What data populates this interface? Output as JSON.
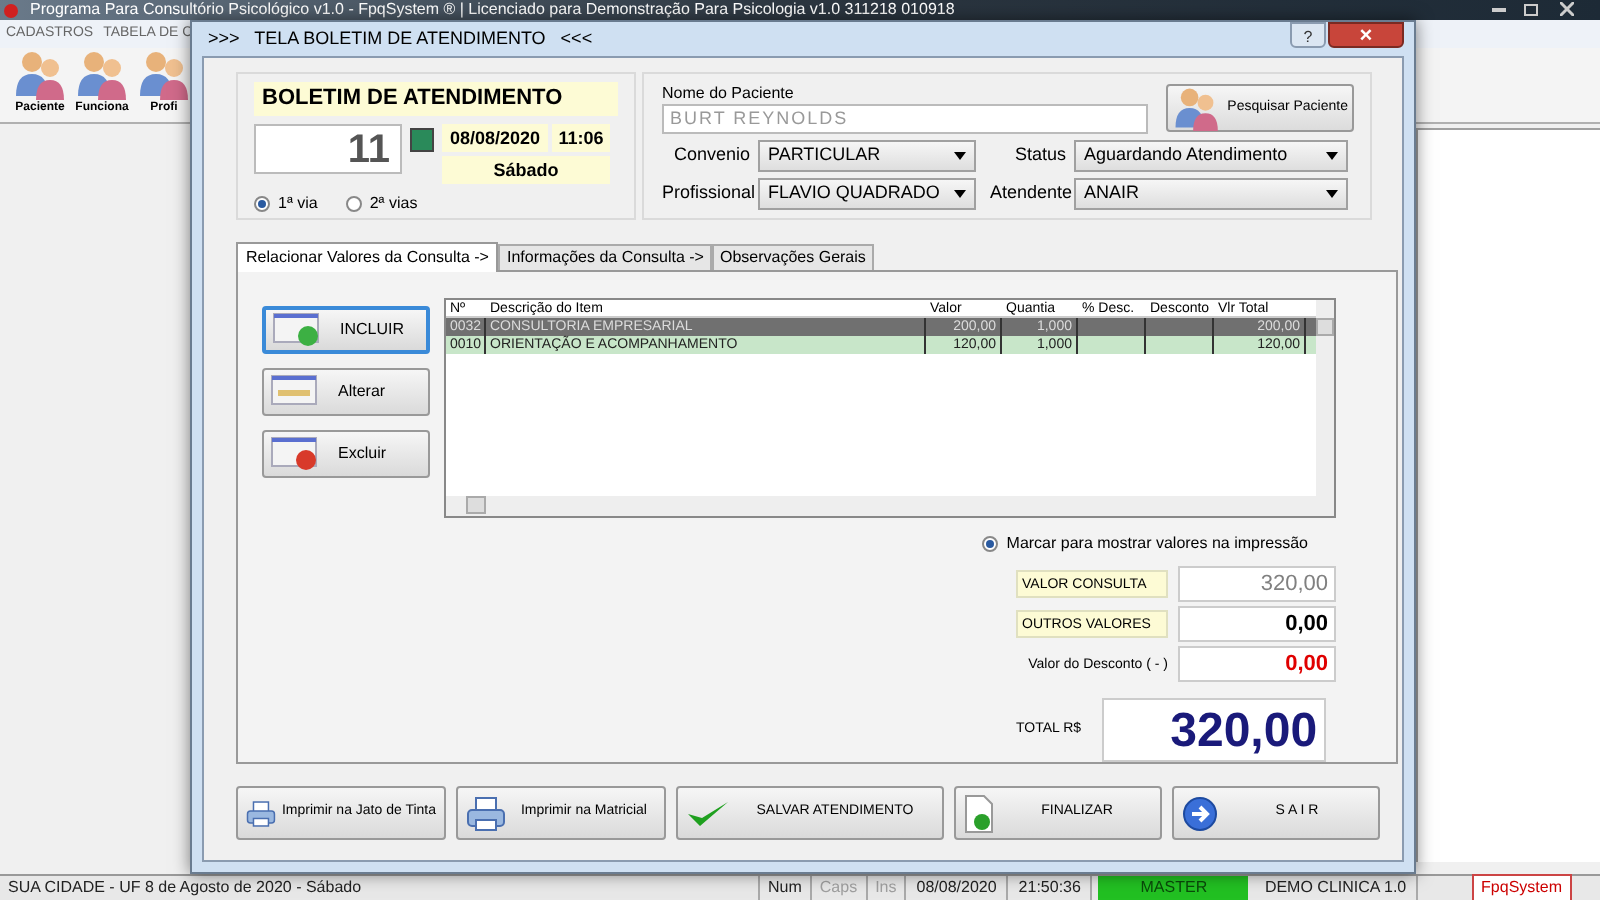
{
  "app": {
    "title": "Programa Para Consultório Psicológico v1.0 - FpqSystem ® | Licenciado para  Demonstração Para Psicologia v1.0 311218 010918",
    "menu": [
      "CADASTROS",
      "TABELA DE C"
    ],
    "toolbar": [
      {
        "label": "Paciente"
      },
      {
        "label": "Funciona"
      },
      {
        "label": "Profi"
      }
    ]
  },
  "dialog": {
    "title": ">>>   TELA BOLETIM DE ATENDIMENTO   <<<",
    "help": "?",
    "close": "×",
    "heading": "BOLETIM DE ATENDIMENTO",
    "number": "11",
    "date": "08/08/2020",
    "time": "11:06",
    "weekday": "Sábado",
    "copies": [
      {
        "label": "1ª via",
        "selected": true
      },
      {
        "label": "2ª vias",
        "selected": false
      }
    ],
    "patient": {
      "label": "Nome do Paciente",
      "value": "BURT REYNOLDS",
      "search_button": "Pesquisar Paciente"
    },
    "selects": [
      {
        "label": "Convenio",
        "value": "PARTICULAR"
      },
      {
        "label": "Status",
        "value": "Aguardando Atendimento"
      },
      {
        "label": "Profissional",
        "value": "FLAVIO QUADRADO"
      },
      {
        "label": "Atendente",
        "value": "ANAIR"
      }
    ],
    "tabs": [
      {
        "label": "Relacionar Valores da Consulta ->",
        "selected": true
      },
      {
        "label": "Informações da Consulta ->",
        "selected": false
      },
      {
        "label": "Observações Gerais",
        "selected": false
      }
    ],
    "actions": [
      {
        "label": "INCLUIR",
        "kind": "add",
        "focused": true
      },
      {
        "label": "Alterar",
        "kind": "edit",
        "focused": false
      },
      {
        "label": "Excluir",
        "kind": "delete",
        "focused": false
      }
    ],
    "table": {
      "columns": [
        "Nº",
        "Descrição do Item",
        "Valor",
        "Quantia",
        "% Desc.",
        "Desconto",
        "Vlr Total"
      ],
      "rows": [
        {
          "cells": [
            "0032",
            "CONSULTORIA EMPRESARIAL",
            "200,00",
            "1,000",
            "",
            "",
            "200,00"
          ],
          "selected": true
        },
        {
          "cells": [
            "0010",
            "ORIENTAÇÃO E ACOMPANHAMENTO",
            "120,00",
            "1,000",
            "",
            "",
            "120,00"
          ],
          "selected": false
        }
      ]
    },
    "print_values": {
      "label": "Marcar para mostrar valores na impressão",
      "checked": true
    },
    "totals": [
      {
        "label": "VALOR CONSULTA",
        "value": "320,00",
        "kind": "highlight",
        "color": "#808080"
      },
      {
        "label": "OUTROS VALORES",
        "value": "0,00",
        "kind": "highlight",
        "color": "#000000"
      },
      {
        "label": "Valor do Desconto ( - )",
        "value": "0,00",
        "kind": "plain",
        "color": "#e00000"
      }
    ],
    "total": {
      "label": "TOTAL R$",
      "value": "320,00"
    },
    "buttons": [
      {
        "label": "Imprimir na Jato de Tinta",
        "kind": "inkjet"
      },
      {
        "label": "Imprimir na Matricial",
        "kind": "matrix"
      },
      {
        "label": "SALVAR  ATENDIMENTO",
        "kind": "save"
      },
      {
        "label": "FINALIZAR",
        "kind": "finish"
      },
      {
        "label": "S A I R",
        "kind": "exit"
      }
    ]
  },
  "status_bar": [
    {
      "text": "SUA CIDADE - UF  8 de Agosto de 2020 - Sábado",
      "kind": "location",
      "disabled": false
    },
    {
      "text": "Num",
      "kind": "key",
      "disabled": false
    },
    {
      "text": "Caps",
      "kind": "key",
      "disabled": true
    },
    {
      "text": "Ins",
      "kind": "key",
      "disabled": true
    },
    {
      "text": "08/08/2020",
      "kind": "plain",
      "disabled": false
    },
    {
      "text": "21:50:36",
      "kind": "plain",
      "disabled": false
    },
    {
      "text": "MASTER",
      "kind": "user",
      "disabled": false
    },
    {
      "text": "DEMO CLINICA 1.0",
      "kind": "plain",
      "disabled": false
    },
    {
      "text": "FpqSystem",
      "kind": "brand",
      "disabled": false
    }
  ]
}
